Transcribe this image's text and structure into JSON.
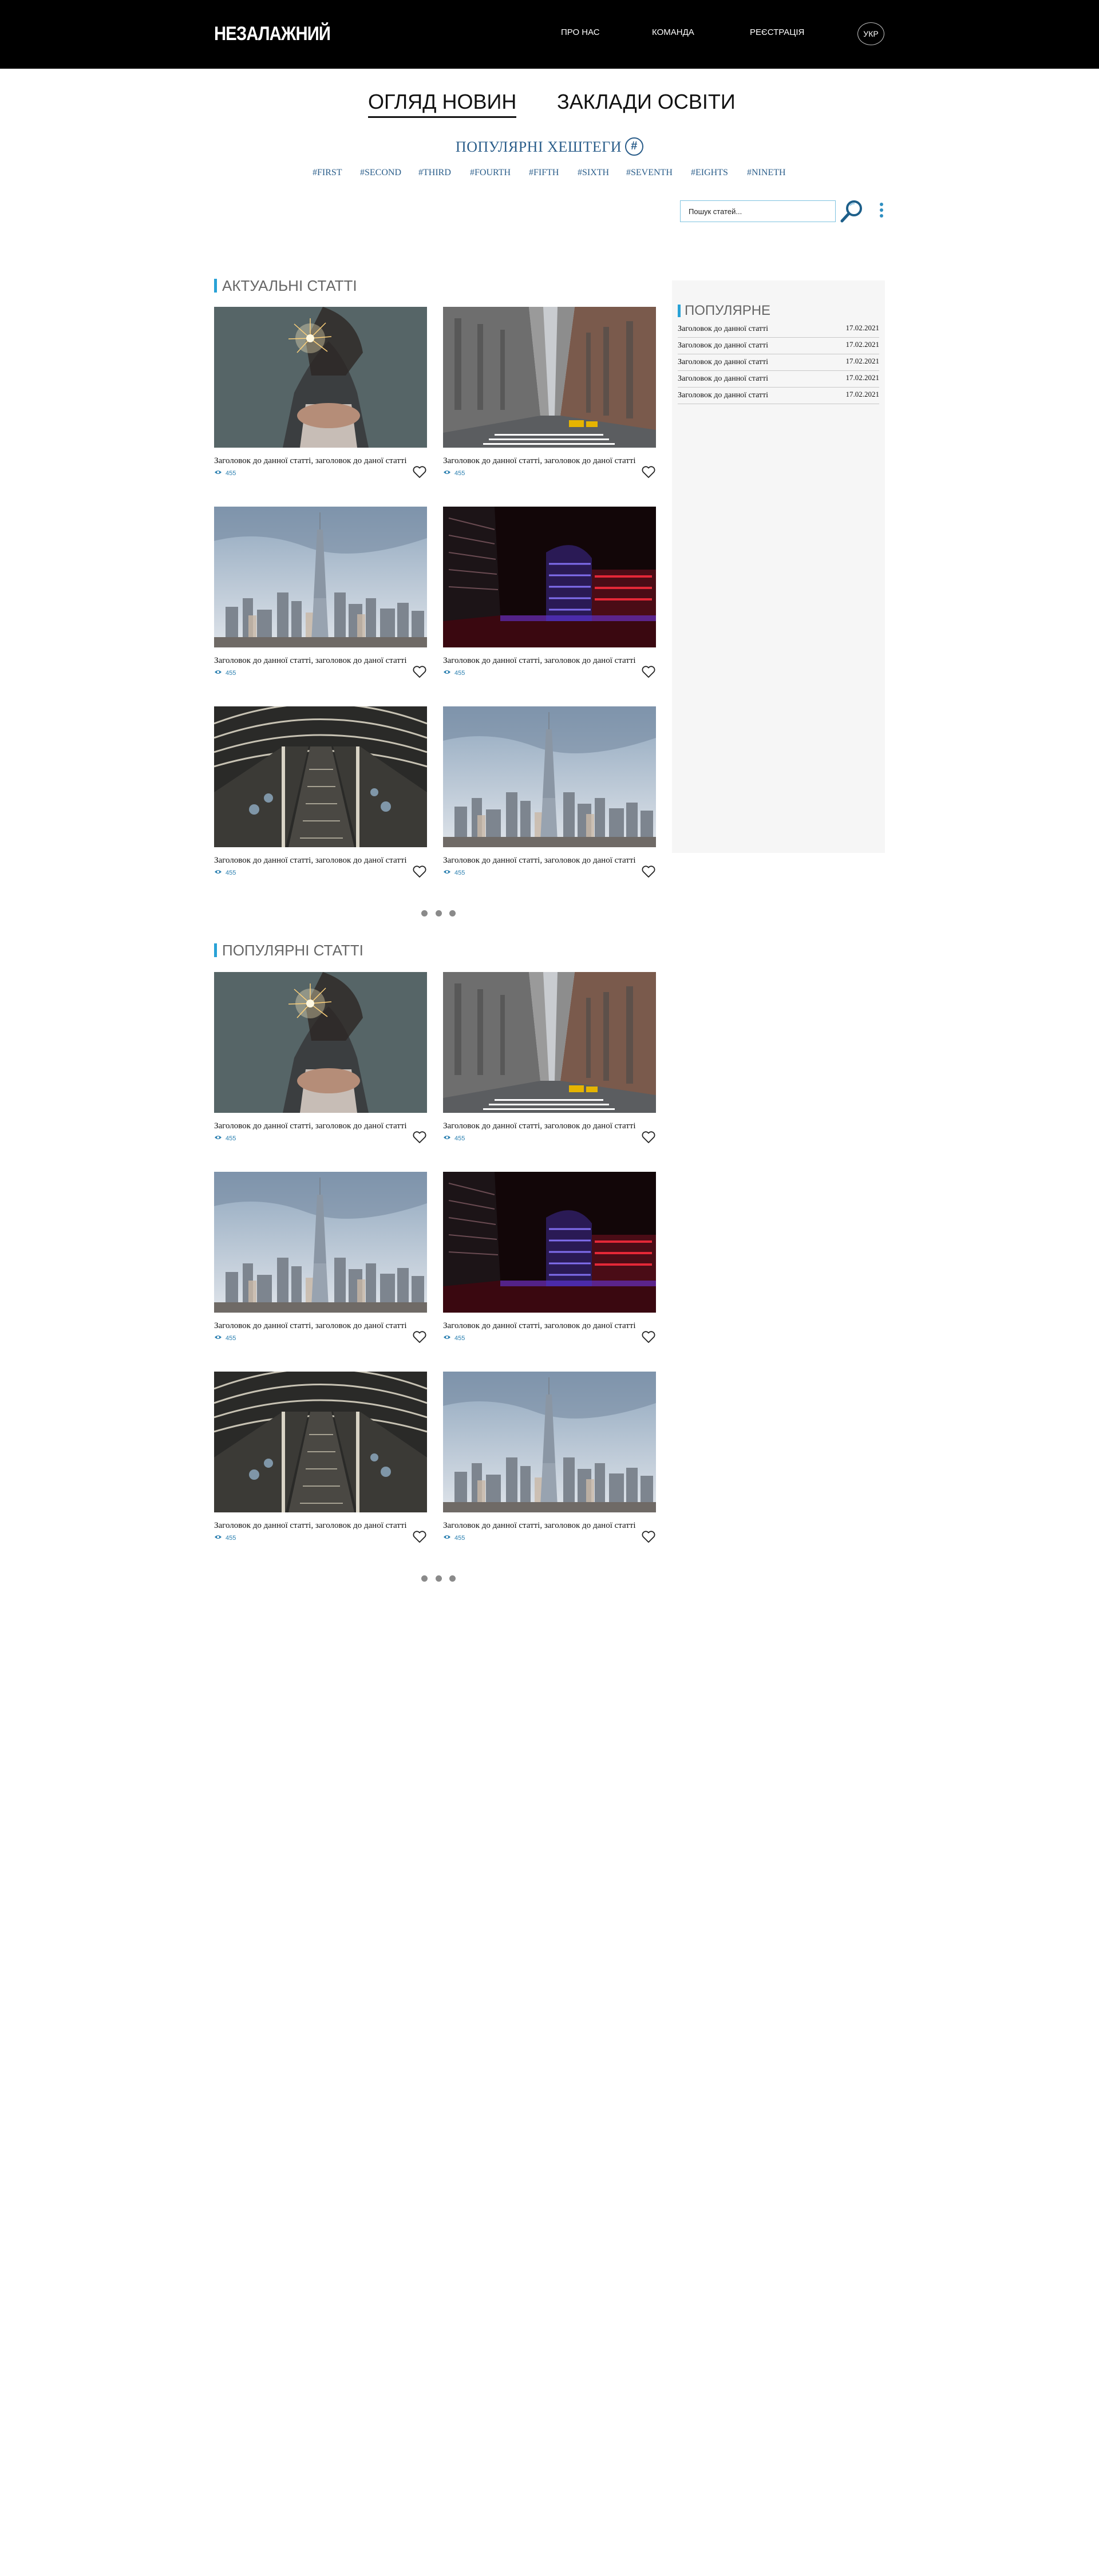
{
  "header": {
    "logo": "НЕЗАЛАЖНИЙ",
    "nav": [
      "ПРО НАС",
      "КОМАНДА",
      "РЕЄСТРАЦІЯ"
    ],
    "lang": "УКР"
  },
  "tabs": [
    {
      "label": "ОГЛЯД НОВИН",
      "active": true
    },
    {
      "label": "ЗАКЛАДИ ОСВІТИ",
      "active": false
    }
  ],
  "hashtags": {
    "title": "ПОПУЛЯРНІ ХЕШТЕГИ",
    "items": [
      "#FIRST",
      "#SECOND",
      "#THIRD",
      "#FOURTH",
      "#FIFTH",
      "#SIXTH",
      "#SEVENTH",
      "#EIGHTS",
      "#NINETH"
    ]
  },
  "search": {
    "placeholder": "Пошук статей..."
  },
  "sections": [
    {
      "title": "АКТУАЛЬНІ СТАТТІ",
      "articles": [
        {
          "image": "sparkler",
          "title": "Заголовок до данної статті, заголовок до даної статті",
          "views": "455"
        },
        {
          "image": "street",
          "title": "Заголовок до данної статті, заголовок до даної статті",
          "views": "455"
        },
        {
          "image": "skyline",
          "title": "Заголовок до данної статті, заголовок до даної статті",
          "views": "455"
        },
        {
          "image": "neon-building",
          "title": "Заголовок до данної статті, заголовок до даної статті",
          "views": "455"
        },
        {
          "image": "escalator",
          "title": "Заголовок до данної статті, заголовок до даної статті",
          "views": "455"
        },
        {
          "image": "skyline",
          "title": "Заголовок до данної статті, заголовок до даної статті",
          "views": "455"
        }
      ]
    },
    {
      "title": "ПОПУЛЯРНІ СТАТТІ",
      "articles": [
        {
          "image": "sparkler",
          "title": "Заголовок до данної статті, заголовок до даної статті",
          "views": "455"
        },
        {
          "image": "street",
          "title": "Заголовок до данної статті, заголовок до даної статті",
          "views": "455"
        },
        {
          "image": "skyline",
          "title": "Заголовок до данної статті, заголовок до даної статті",
          "views": "455"
        },
        {
          "image": "neon-building",
          "title": "Заголовок до данної статті, заголовок до даної статті",
          "views": "455"
        },
        {
          "image": "escalator",
          "title": "Заголовок до данної статті, заголовок до даної статті",
          "views": "455"
        },
        {
          "image": "skyline",
          "title": "Заголовок до данної статті, заголовок до даної статті",
          "views": "455"
        }
      ]
    }
  ],
  "sidebar": {
    "title": "ПОПУЛЯРНЕ",
    "items": [
      {
        "title": "Заголовок до данної статті",
        "date": "17.02.2021"
      },
      {
        "title": "Заголовок до данної статті",
        "date": "17.02.2021"
      },
      {
        "title": "Заголовок до данної статті",
        "date": "17.02.2021"
      },
      {
        "title": "Заголовок до данної статті",
        "date": "17.02.2021"
      },
      {
        "title": "Заголовок до данної статті",
        "date": "17.02.2021"
      }
    ]
  },
  "icons": {
    "hashtag": "hash-circle-icon",
    "search": "magnifier-icon",
    "menu": "kebab-menu-icon",
    "views": "eye-icon",
    "like": "heart-icon",
    "more": "more-dots-icon"
  },
  "colors": {
    "header_bg": "#000000",
    "accent": "#29a2d6",
    "link": "#2a5d8a",
    "sidebar_bg": "#f6f6f6"
  }
}
